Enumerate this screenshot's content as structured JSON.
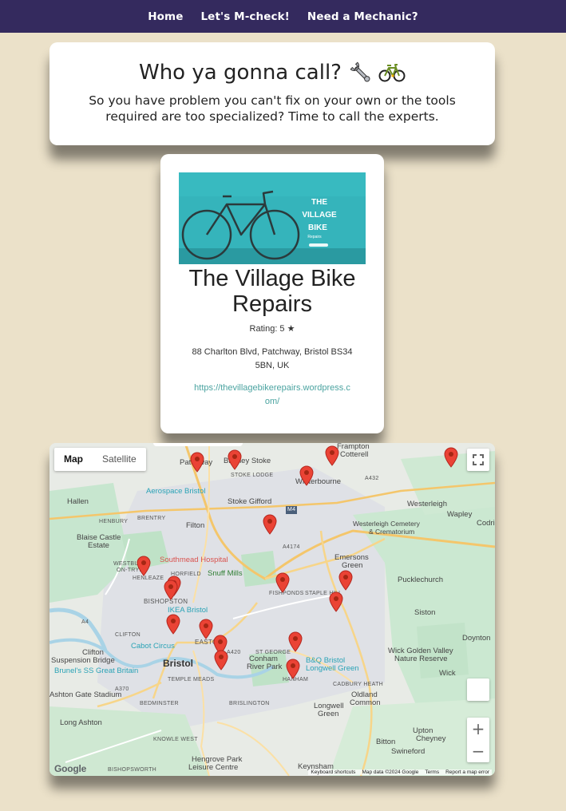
{
  "nav": {
    "items": [
      "Home",
      "Let's M-check!",
      "Need a Mechanic?"
    ]
  },
  "hero": {
    "title": "Who ya gonna call?",
    "subtitle": "So you have problem you can't fix on your own or the tools required are too specialized? Time to call the experts.",
    "emoji_icons": [
      "wrench-icon",
      "bicycle-icon"
    ]
  },
  "card": {
    "image_text": {
      "line1": "THE",
      "line2": "VILLAGE",
      "line3": "BIKE",
      "line4": "Repairs"
    },
    "title": "The Village Bike Repairs",
    "rating": "Rating: 5 ★",
    "address": "88 Charlton Blvd, Patchway, Bristol BS34 5BN, UK",
    "link": "https://thevillagebikerepairs.wordpress.com/"
  },
  "map": {
    "type_buttons": [
      "Map",
      "Satellite"
    ],
    "google_logo": "Google",
    "footer": [
      "Keyboard shortcuts",
      "Map data ©2024 Google",
      "Terms",
      "Report a map error"
    ],
    "zoom_in": "+",
    "zoom_out": "−",
    "labels": [
      {
        "text": "Frampton",
        "cls": ""
      },
      {
        "text": "Cotterell",
        "cls": ""
      },
      {
        "text": "Patchway",
        "cls": ""
      },
      {
        "text": "Bradley Stoke",
        "cls": ""
      },
      {
        "text": "STOKE LODGE",
        "cls": "small"
      },
      {
        "text": "Winterbourne",
        "cls": ""
      },
      {
        "text": "Aerospace Bristol",
        "cls": "poi"
      },
      {
        "text": "Hallen",
        "cls": ""
      },
      {
        "text": "Stoke Gifford",
        "cls": ""
      },
      {
        "text": "Westerleigh",
        "cls": ""
      },
      {
        "text": "HENBURY",
        "cls": "small"
      },
      {
        "text": "BRENTRY",
        "cls": "small"
      },
      {
        "text": "Wapley",
        "cls": ""
      },
      {
        "text": "Filton",
        "cls": ""
      },
      {
        "text": "Westerleigh Cemetery",
        "cls": ""
      },
      {
        "text": "& Crematorium",
        "cls": ""
      },
      {
        "text": "Codri",
        "cls": ""
      },
      {
        "text": "Blaise Castle",
        "cls": ""
      },
      {
        "text": "Estate",
        "cls": ""
      },
      {
        "text": "Southmead Hospital",
        "cls": "hosp"
      },
      {
        "text": "Emersons",
        "cls": ""
      },
      {
        "text": "Green",
        "cls": ""
      },
      {
        "text": "WESTBURY",
        "cls": "small"
      },
      {
        "text": "ON-TRYM",
        "cls": "small"
      },
      {
        "text": "HENLEAZE",
        "cls": "small"
      },
      {
        "text": "HORFIELD",
        "cls": "small"
      },
      {
        "text": "Snuff Mills",
        "cls": "green"
      },
      {
        "text": "Pucklechurch",
        "cls": ""
      },
      {
        "text": "BISHOPSTON",
        "cls": "small"
      },
      {
        "text": "FISHPONDS",
        "cls": "small"
      },
      {
        "text": "STAPLE HILL",
        "cls": "small"
      },
      {
        "text": "IKEA Bristol",
        "cls": "poi"
      },
      {
        "text": "Siston",
        "cls": ""
      },
      {
        "text": "CLIFTON",
        "cls": "small"
      },
      {
        "text": "Cabot Circus",
        "cls": "poi"
      },
      {
        "text": "EASTON",
        "cls": "small"
      },
      {
        "text": "Doynton",
        "cls": ""
      },
      {
        "text": "Clifton",
        "cls": ""
      },
      {
        "text": "Suspension Bridge",
        "cls": ""
      },
      {
        "text": "ST GEORGE",
        "cls": "small"
      },
      {
        "text": "Wick Golden Valley",
        "cls": ""
      },
      {
        "text": "Nature Reserve",
        "cls": ""
      },
      {
        "text": "B&Q Bristol",
        "cls": "poi"
      },
      {
        "text": "Longwell Green",
        "cls": "poi"
      },
      {
        "text": "Brunel's SS Great Britain",
        "cls": "poi"
      },
      {
        "text": "Bristol",
        "cls": ""
      },
      {
        "text": "Conham",
        "cls": ""
      },
      {
        "text": "River Park",
        "cls": ""
      },
      {
        "text": "Wick",
        "cls": ""
      },
      {
        "text": "TEMPLE MEADS",
        "cls": "small"
      },
      {
        "text": "HANHAM",
        "cls": "small"
      },
      {
        "text": "CADBURY HEATH",
        "cls": "small"
      },
      {
        "text": "Oldland",
        "cls": ""
      },
      {
        "text": "Common",
        "cls": ""
      },
      {
        "text": "Ashton Gate Stadium",
        "cls": ""
      },
      {
        "text": "BEDMINSTER",
        "cls": "small"
      },
      {
        "text": "BRISLINGTON",
        "cls": "small"
      },
      {
        "text": "Longwell",
        "cls": ""
      },
      {
        "text": "Green",
        "cls": ""
      },
      {
        "text": "Long Ashton",
        "cls": ""
      },
      {
        "text": "Upton",
        "cls": ""
      },
      {
        "text": "Cheyney",
        "cls": ""
      },
      {
        "text": "Bitton",
        "cls": ""
      },
      {
        "text": "KNOWLE WEST",
        "cls": "small"
      },
      {
        "text": "Swineford",
        "cls": ""
      },
      {
        "text": "Hengrove Park",
        "cls": ""
      },
      {
        "text": "Leisure Centre",
        "cls": ""
      },
      {
        "text": "BISHOPSWORTH",
        "cls": "small"
      },
      {
        "text": "Keynsham",
        "cls": ""
      },
      {
        "text": "M4",
        "cls": "small"
      },
      {
        "text": "A4174",
        "cls": "small"
      },
      {
        "text": "A432",
        "cls": "small"
      },
      {
        "text": "A420",
        "cls": "small"
      },
      {
        "text": "A370",
        "cls": "small"
      },
      {
        "text": "A4",
        "cls": "small"
      }
    ],
    "marker_count": 16
  }
}
